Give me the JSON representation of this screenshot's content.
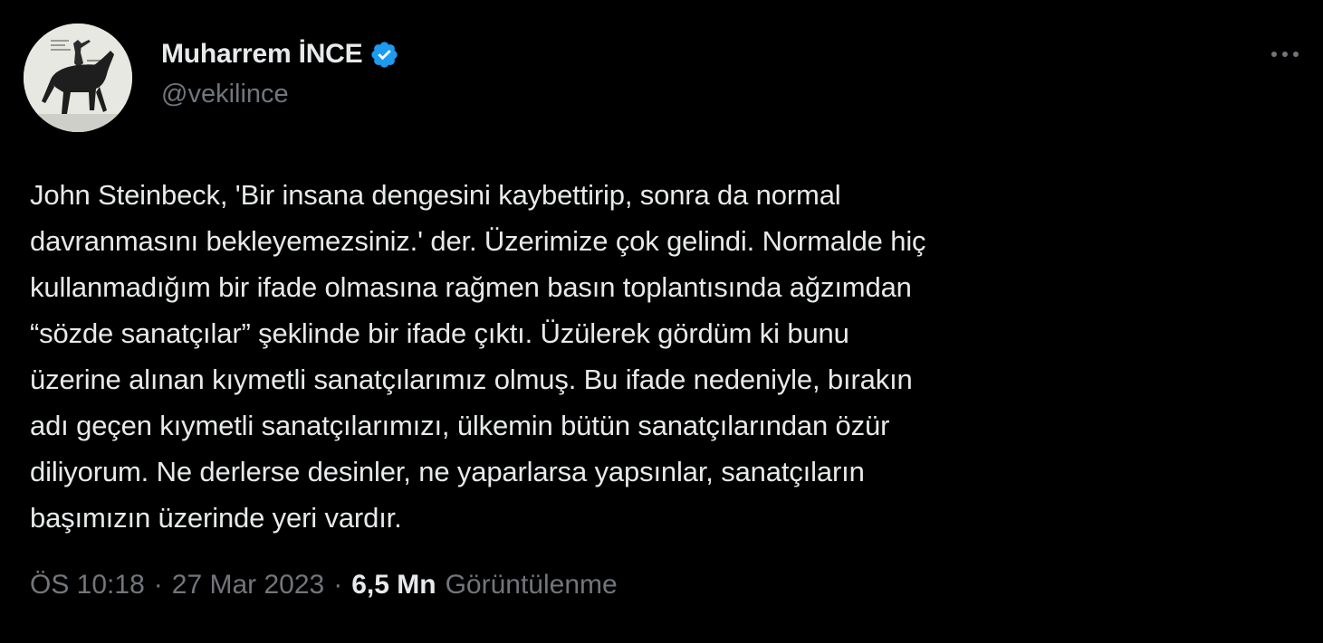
{
  "author": {
    "display_name": "Muharrem İNCE",
    "handle": "@vekilince",
    "verified_icon": "verified-badge-icon",
    "avatar_icon": "avatar-horse-rider-image"
  },
  "actions": {
    "more_icon": "more-horizontal-icon"
  },
  "tweet": {
    "text": "John Steinbeck, 'Bir insana dengesini kaybettirip, sonra da normal\ndavranmasını bekleyemezsiniz.' der. Üzerimize çok gelindi. Normalde hiç\nkullanmadığım bir ifade olmasına rağmen basın toplantısında ağzımdan\n“sözde sanatçılar” şeklinde bir ifade çıktı. Üzülerek gördüm ki bunu\nüzerine alınan kıymetli sanatçılarımız olmuş. Bu ifade nedeniyle, bırakın\nadı geçen kıymetli sanatçılarımızı, ülkemin bütün sanatçılarından özür\ndiliyorum. Ne derlerse desinler, ne yaparlarsa yapsınlar, sanatçıların\nbaşımızın üzerinde yeri vardır."
  },
  "meta": {
    "time": "ÖS 10:18",
    "separator": "·",
    "date": "27 Mar 2023",
    "views_count": "6,5 Mn",
    "views_label": "Görüntülenme"
  },
  "colors": {
    "background": "#000000",
    "primary_text": "#e7e9ea",
    "secondary_text": "#71767b",
    "verified_blue": "#1d9bf0"
  }
}
